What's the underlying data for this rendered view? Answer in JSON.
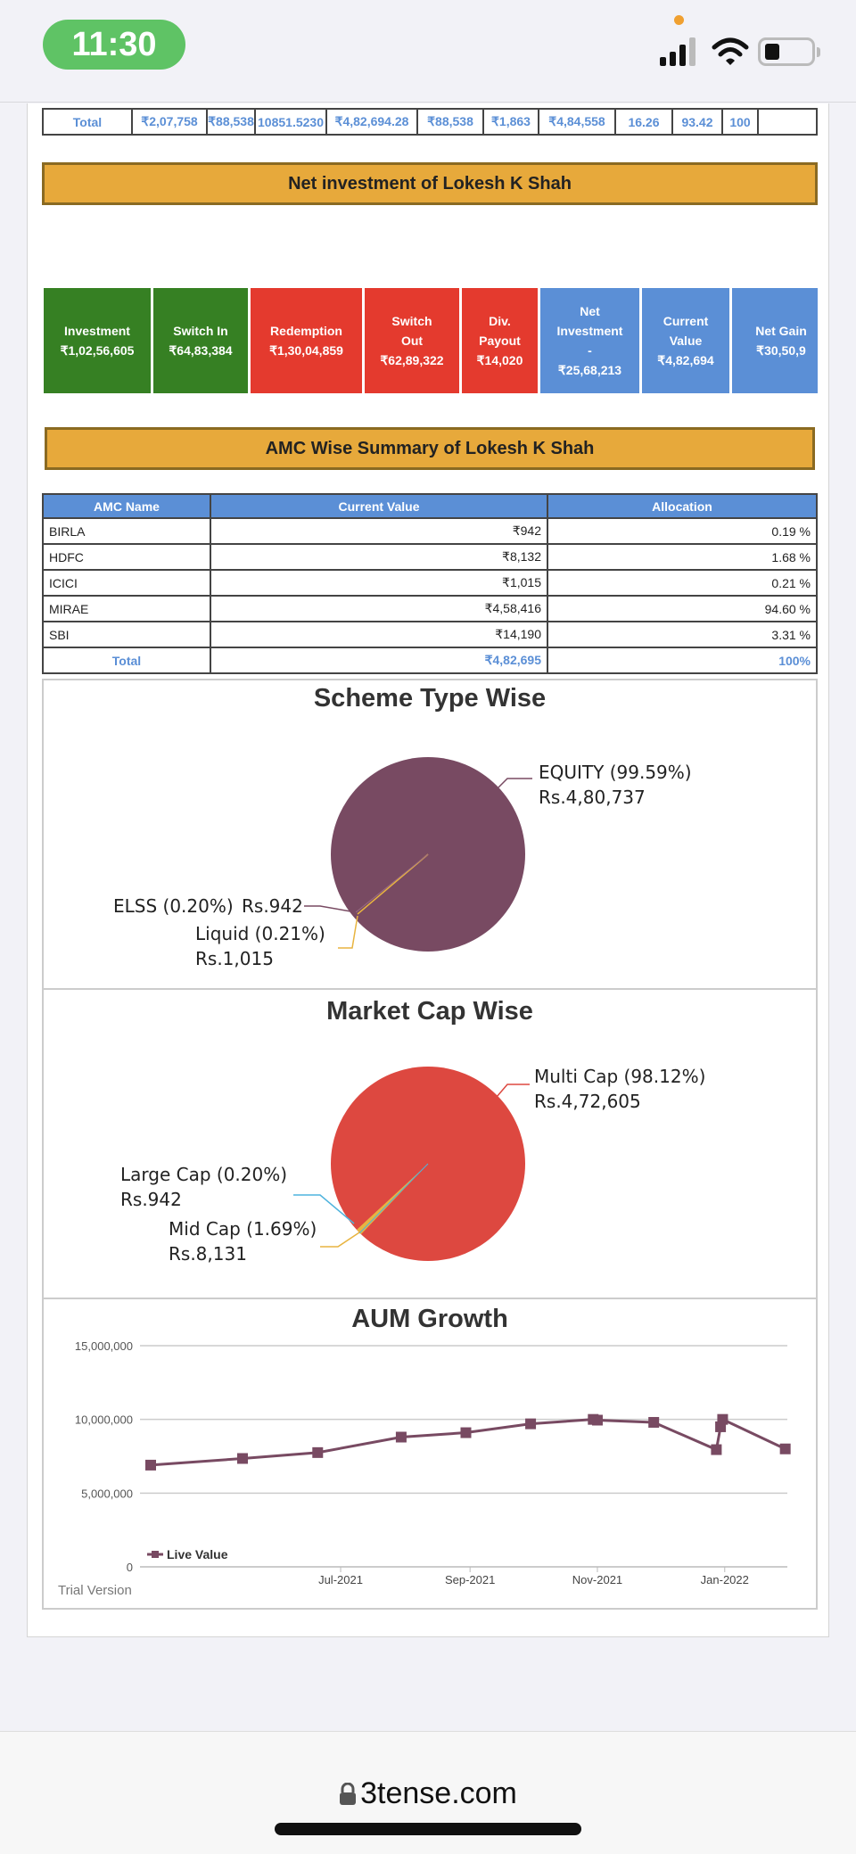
{
  "status_bar": {
    "time": "11:30"
  },
  "holdings_total": {
    "label": "Total",
    "cells": [
      "₹2,07,758",
      "₹88,538",
      "10851.5230",
      "₹4,82,694.28",
      "₹88,538",
      "₹1,863",
      "₹4,84,558",
      "16.26",
      "93.42",
      "100"
    ]
  },
  "net_investment": {
    "title": "Net investment of Lokesh K Shah",
    "cards": [
      {
        "lines": [
          "Investment",
          "₹1,02,56,605"
        ],
        "color": "#368023"
      },
      {
        "lines": [
          "Switch In",
          "₹64,83,384"
        ],
        "color": "#368023"
      },
      {
        "lines": [
          "Redemption",
          "₹1,30,04,859"
        ],
        "color": "#e43a2e"
      },
      {
        "lines": [
          "Switch",
          "Out",
          "₹62,89,322"
        ],
        "color": "#e43a2e"
      },
      {
        "lines": [
          "Div.",
          "Payout",
          "₹14,020"
        ],
        "color": "#e43a2e"
      },
      {
        "lines": [
          "Net",
          "Investment",
          "-",
          "₹25,68,213"
        ],
        "color": "#5b8fd6"
      },
      {
        "lines": [
          "Current",
          "Value",
          "₹4,82,694"
        ],
        "color": "#5b8fd6"
      },
      {
        "lines": [
          "Net Gain",
          "₹30,50,9"
        ],
        "color": "#5b8fd6"
      }
    ]
  },
  "amc_summary": {
    "title": "AMC Wise Summary of Lokesh K Shah",
    "headers": [
      "AMC Name",
      "Current Value",
      "Allocation"
    ],
    "rows": [
      [
        "BIRLA",
        "₹942",
        "0.19 %"
      ],
      [
        "HDFC",
        "₹8,132",
        "1.68 %"
      ],
      [
        "ICICI",
        "₹1,015",
        "0.21 %"
      ],
      [
        "MIRAE",
        "₹4,58,416",
        "94.60 %"
      ],
      [
        "SBI",
        "₹14,190",
        "3.31 %"
      ]
    ],
    "total": [
      "Total",
      "₹4,82,695",
      "100%"
    ]
  },
  "scheme_chart": {
    "title": "Scheme Type Wise",
    "slices": [
      {
        "label": "EQUITY (99.59%)",
        "value_label": "Rs.4,80,737",
        "value": 480737,
        "color": "#784a62"
      },
      {
        "label": "ELSS (0.20%)",
        "value_label": "Rs.942",
        "value": 942,
        "color": "#784a62"
      },
      {
        "label": "Liquid (0.21%)",
        "value_label": "Rs.1,015",
        "value": 1015,
        "color": "#e8b440"
      }
    ]
  },
  "market_cap_chart": {
    "title": "Market Cap Wise",
    "slices": [
      {
        "label": "Multi Cap (98.12%)",
        "value_label": "Rs.4,72,605",
        "value": 472605,
        "color": "#dd4840"
      },
      {
        "label": "Large Cap (0.20%)",
        "value_label": "Rs.942",
        "value": 942,
        "color": "#4fb3dd"
      },
      {
        "label": "Mid Cap (1.69%)",
        "value_label": "Rs.8,131",
        "value": 8131,
        "color": "#e8b440"
      }
    ]
  },
  "chart_data": {
    "type": "line",
    "title": "AUM Growth",
    "xlabel": "",
    "ylabel": "",
    "ylim": [
      0,
      15000000
    ],
    "yticks": [
      "0",
      "5,000,000",
      "10,000,000",
      "15,000,000"
    ],
    "xticks": [
      "Jul-2021",
      "Sep-2021",
      "Nov-2021",
      "Jan-2022"
    ],
    "series": [
      {
        "name": "Live Value",
        "color": "#784a62",
        "x": [
          "2021-04-01",
          "2021-05-15",
          "2021-06-20",
          "2021-07-30",
          "2021-08-30",
          "2021-09-30",
          "2021-10-30",
          "2021-11-01",
          "2021-11-28",
          "2021-12-28",
          "2021-12-30",
          "2021-12-31",
          "2022-01-30"
        ],
        "values": [
          6900000,
          7350000,
          7750000,
          8800000,
          9100000,
          9700000,
          10000000,
          9950000,
          9800000,
          7950000,
          9500000,
          10000000,
          8000000
        ]
      }
    ],
    "legend": "bottom-left",
    "grid": true
  },
  "watermark": "Trial Version",
  "browser": {
    "url": "3tense.com"
  }
}
